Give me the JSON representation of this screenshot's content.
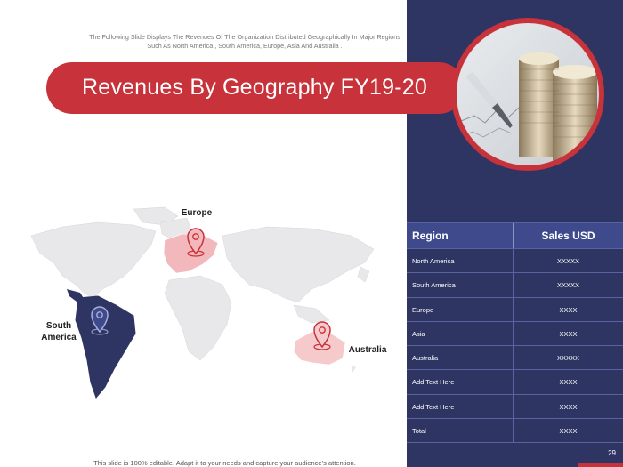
{
  "slide": {
    "subtitle": "The Following Slide Displays The Revenues Of The Organization Distributed Geographically In Major Regions Such As North America , South America, Europe, Asia And Australia .",
    "title": "Revenues By Geography FY19-20",
    "footer": "This slide is 100% editable. Adapt it to your needs and capture your audience’s attention.",
    "page_number": "29"
  },
  "map": {
    "labels": {
      "europe": "Europe",
      "south_america": "South America",
      "australia": "Australia"
    },
    "highlight_colors": {
      "south_america": "#2e3563",
      "europe": "#f2b8bb",
      "australia": "#f6c9cb",
      "land": "#e8e8ea",
      "pin": "#c8323a"
    }
  },
  "table": {
    "headers": {
      "region": "Region",
      "sales": "Sales USD"
    },
    "rows": [
      {
        "region": "North America",
        "sales": "XXXXX"
      },
      {
        "region": "South America",
        "sales": "XXXXX"
      },
      {
        "region": "Europe",
        "sales": "XXXX"
      },
      {
        "region": "Asia",
        "sales": "XXXX"
      },
      {
        "region": "Australia",
        "sales": "XXXXX"
      },
      {
        "region": "Add Text Here",
        "sales": "XXXX"
      },
      {
        "region": "Add Text Here",
        "sales": "XXXX"
      },
      {
        "region": "Total",
        "sales": "XXXX"
      }
    ]
  },
  "colors": {
    "accent_red": "#c8323a",
    "navy": "#2e3563",
    "table_header": "#3f4a8c"
  }
}
